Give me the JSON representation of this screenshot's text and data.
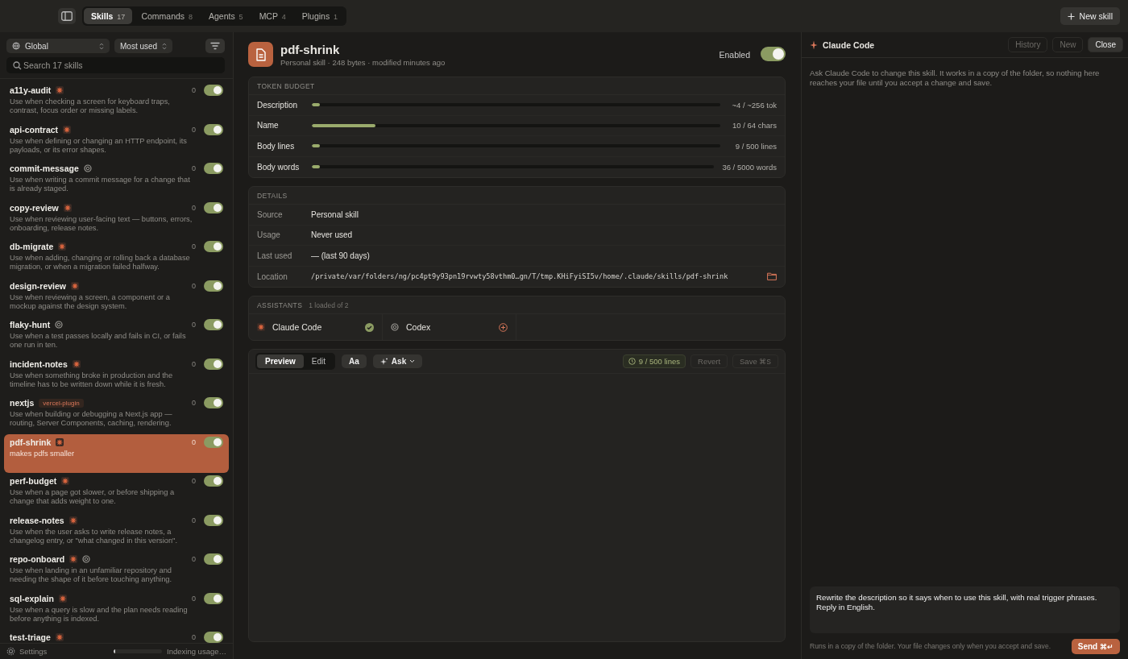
{
  "topbar": {
    "tabs": [
      {
        "label": "Skills",
        "count": "17",
        "selected": true
      },
      {
        "label": "Commands",
        "count": "8",
        "selected": false
      },
      {
        "label": "Agents",
        "count": "5",
        "selected": false
      },
      {
        "label": "MCP",
        "count": "4",
        "selected": false
      },
      {
        "label": "Plugins",
        "count": "1",
        "selected": false
      }
    ],
    "new_button": "New skill"
  },
  "sidebar": {
    "scope": "Global",
    "sort": "Most used",
    "search": {
      "placeholder": "Search 17 skills"
    },
    "items": [
      {
        "name": "a11y-audit",
        "badges": [
          {
            "kind": "claude"
          }
        ],
        "count": "0",
        "on": true,
        "selected": false,
        "description": "Use when checking a screen for keyboard traps, contrast, focus order or missing labels."
      },
      {
        "name": "api-contract",
        "badges": [
          {
            "kind": "claude"
          }
        ],
        "count": "0",
        "on": true,
        "selected": false,
        "description": "Use when defining or changing an HTTP endpoint, its payloads, or its error shapes."
      },
      {
        "name": "commit-message",
        "badges": [
          {
            "kind": "codex"
          }
        ],
        "count": "0",
        "on": true,
        "selected": false,
        "description": "Use when writing a commit message for a change that is already staged."
      },
      {
        "name": "copy-review",
        "badges": [
          {
            "kind": "claude"
          }
        ],
        "count": "0",
        "on": true,
        "selected": false,
        "description": "Use when reviewing user-facing text — buttons, errors, onboarding, release notes."
      },
      {
        "name": "db-migrate",
        "badges": [
          {
            "kind": "claude"
          }
        ],
        "count": "0",
        "on": true,
        "selected": false,
        "description": "Use when adding, changing or rolling back a database migration, or when a migration failed halfway."
      },
      {
        "name": "design-review",
        "badges": [
          {
            "kind": "claude"
          }
        ],
        "count": "0",
        "on": true,
        "selected": false,
        "description": "Use when reviewing a screen, a component or a mockup against the design system."
      },
      {
        "name": "flaky-hunt",
        "badges": [
          {
            "kind": "codex"
          }
        ],
        "count": "0",
        "on": true,
        "selected": false,
        "description": "Use when a test passes locally and fails in CI, or fails one run in ten."
      },
      {
        "name": "incident-notes",
        "badges": [
          {
            "kind": "claude"
          }
        ],
        "count": "0",
        "on": true,
        "selected": false,
        "description": "Use when something broke in production and the timeline has to be written down while it is fresh."
      },
      {
        "name": "nextjs",
        "badges": [
          {
            "kind": "tag",
            "label": "vercel-plugin"
          }
        ],
        "count": "0",
        "on": true,
        "selected": false,
        "description": "Use when building or debugging a Next.js app — routing, Server Components, caching, rendering."
      },
      {
        "name": "pdf-shrink",
        "badges": [
          {
            "kind": "claude"
          }
        ],
        "count": "0",
        "on": true,
        "selected": true,
        "description": "makes pdfs smaller"
      },
      {
        "name": "perf-budget",
        "badges": [
          {
            "kind": "claude"
          }
        ],
        "count": "0",
        "on": true,
        "selected": false,
        "description": "Use when a page got slower, or before shipping a change that adds weight to one."
      },
      {
        "name": "release-notes",
        "badges": [
          {
            "kind": "claude"
          }
        ],
        "count": "0",
        "on": true,
        "selected": false,
        "description": "Use when the user asks to write release notes, a changelog entry, or \"what changed in this version\"."
      },
      {
        "name": "repo-onboard",
        "badges": [
          {
            "kind": "claude"
          },
          {
            "kind": "codex"
          }
        ],
        "count": "0",
        "on": true,
        "selected": false,
        "description": "Use when landing in an unfamiliar repository and needing the shape of it before touching anything."
      },
      {
        "name": "sql-explain",
        "badges": [
          {
            "kind": "claude"
          }
        ],
        "count": "0",
        "on": true,
        "selected": false,
        "description": "Use when a query is slow and the plan needs reading before anything is indexed."
      },
      {
        "name": "test-triage",
        "badges": [
          {
            "kind": "claude"
          }
        ],
        "count": "0",
        "on": true,
        "selected": false
      }
    ],
    "footer": {
      "settings": "Settings",
      "progress": {
        "level": 0.03
      },
      "status": "Indexing usage…"
    }
  },
  "skill": {
    "title": "pdf-shrink",
    "meta": "Personal skill · 248 bytes · modified minutes ago",
    "enabled_label": "Enabled",
    "enabled": true,
    "token_budget": {
      "heading": "TOKEN BUDGET",
      "rows": [
        {
          "label": "Description",
          "level": 0.02,
          "reading": "~4 / ~256 tok"
        },
        {
          "label": "Name",
          "level": 0.156,
          "reading": "10 / 64 chars"
        },
        {
          "label": "Body lines",
          "level": 0.02,
          "reading": "9 / 500 lines"
        },
        {
          "label": "Body words",
          "level": 0.02,
          "reading": "36 / 5000 words"
        }
      ]
    },
    "details": {
      "heading": "DETAILS",
      "rows": [
        {
          "label": "Source",
          "value": "Personal skill"
        },
        {
          "label": "Usage",
          "value": "Never used"
        },
        {
          "label": "Last used",
          "value": "— (last 90 days)"
        },
        {
          "label": "Location",
          "value": "/private/var/folders/ng/pc4pt9y93pn19rvwty58vthm0…gn/T/tmp.KHiFyiSI5v/home/.claude/skills/pdf-shrink",
          "kind": "path"
        }
      ]
    },
    "assistants": {
      "heading": "ASSISTANTS",
      "summary": "1 loaded of 2",
      "items": [
        {
          "name": "Claude Code",
          "kind": "claude",
          "loaded": true
        },
        {
          "name": "Codex",
          "kind": "codex",
          "loaded": false
        }
      ]
    },
    "editor": {
      "tabs": [
        {
          "label": "Preview",
          "selected": true
        },
        {
          "label": "Edit",
          "selected": false
        }
      ],
      "font_button": "Aa",
      "ask_button": "Ask",
      "lines": "9 / 500 lines",
      "revert": {
        "label": "Revert",
        "disabled": true
      },
      "save": {
        "label": "Save",
        "shortcut": "⌘S",
        "disabled": true
      }
    }
  },
  "assistant_panel": {
    "title": "Claude Code",
    "buttons": [
      {
        "label": "History",
        "disabled": true
      },
      {
        "label": "New",
        "disabled": true
      },
      {
        "label": "Close",
        "disabled": false
      }
    ],
    "intro": "Ask Claude Code to change this skill. It works in a copy of the folder, so nothing here reaches your file until you accept a change and save.",
    "prompt": "Rewrite the description so it says when to use this skill, with real trigger phrases. Reply in English.",
    "note": "Runs in a copy of the folder. Your file changes only when you accept and save.",
    "send": {
      "label": "Send",
      "shortcut": "⌘↵"
    }
  }
}
